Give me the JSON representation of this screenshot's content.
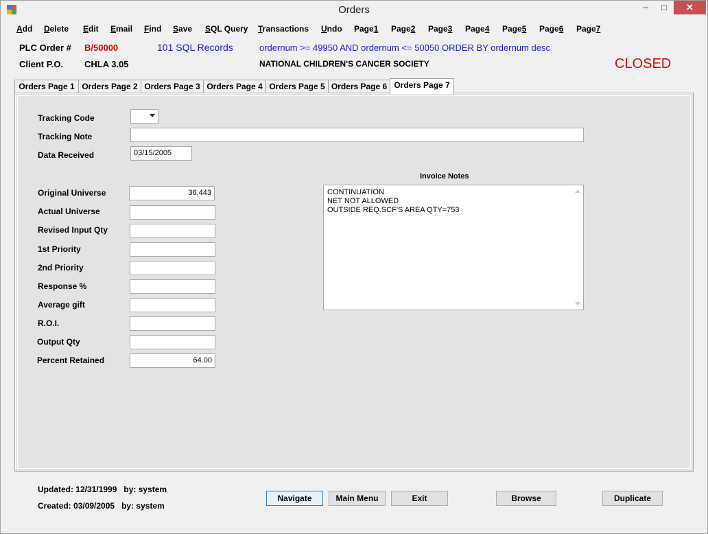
{
  "window": {
    "title": "Orders",
    "controls": {
      "minimize": "–",
      "maximize": "□",
      "close": "✕"
    }
  },
  "menu": [
    {
      "label": "Add",
      "accel": "A",
      "rest": "dd"
    },
    {
      "label": "Delete",
      "accel": "D",
      "rest": "elete"
    },
    {
      "label": "Edit",
      "accel": "E",
      "rest": "dit"
    },
    {
      "label": "Email",
      "accel": "E",
      "rest": "mail"
    },
    {
      "label": "Find",
      "accel": "F",
      "rest": "ind"
    },
    {
      "label": "Save",
      "accel": "S",
      "rest": "ave"
    },
    {
      "label": "SQL Query",
      "accel": "S",
      "rest": "QL Query"
    },
    {
      "label": "Transactions",
      "accel": "T",
      "rest": "ransactions"
    },
    {
      "label": "Undo",
      "accel": "U",
      "rest": "ndo"
    },
    {
      "label": "Page1",
      "pre": "Page",
      "accel": "1"
    },
    {
      "label": "Page2",
      "pre": "Page",
      "accel": "2"
    },
    {
      "label": "Page3",
      "pre": "Page",
      "accel": "3"
    },
    {
      "label": "Page4",
      "pre": "Page",
      "accel": "4"
    },
    {
      "label": "Page5",
      "pre": "Page",
      "accel": "5"
    },
    {
      "label": "Page6",
      "pre": "Page",
      "accel": "6"
    },
    {
      "label": "Page7",
      "pre": "Page",
      "accel": "7"
    }
  ],
  "header": {
    "plc_order_label": "PLC Order #",
    "plc_order_value": "B/50000",
    "sql_records": "101 SQL Records",
    "sql_filter": "ordernum >= 49950 AND ordernum <= 50050 ORDER BY ordernum desc",
    "client_po_label": "Client P.O.",
    "client_po_value": "CHLA 3.05",
    "client_name": "NATIONAL CHILDREN'S CANCER SOCIETY",
    "status": "CLOSED",
    "colors": {
      "red": "#e00000",
      "blue": "#1a1ad6"
    }
  },
  "tabs": [
    {
      "label": "Orders Page 1"
    },
    {
      "label": "Orders Page 2"
    },
    {
      "label": "Orders Page 3"
    },
    {
      "label": "Orders Page 4"
    },
    {
      "label": "Orders Page 5"
    },
    {
      "label": "Orders Page 6"
    },
    {
      "label": "Orders Page 7",
      "active": true
    }
  ],
  "form": {
    "tracking_code_label": "Tracking Code",
    "tracking_code_value": "",
    "tracking_note_label": "Tracking Note",
    "tracking_note_value": "",
    "data_received_label": "Data Received",
    "data_received_value": "03/15/2005",
    "original_universe_label": "Original Universe",
    "original_universe_value": "36,443",
    "actual_universe_label": "Actual Universe",
    "actual_universe_value": "",
    "revised_input_qty_label": "Revised Input Qty",
    "revised_input_qty_value": "",
    "first_priority_label": "1st Priority",
    "first_priority_value": "",
    "second_priority_label": "2nd Priority",
    "second_priority_value": "",
    "response_pct_label": "Response %",
    "response_pct_value": "",
    "average_gift_label": "Average gift",
    "average_gift_value": "",
    "roi_label": "R.O.I.",
    "roi_value": "",
    "output_qty_label": "Output Qty",
    "output_qty_value": "",
    "percent_retained_label": "Percent Retained",
    "percent_retained_value": "64.00",
    "invoice_notes_label": "Invoice Notes",
    "invoice_notes_lines": [
      "CONTINUATION",
      "NET NOT ALLOWED",
      "OUTSIDE REQ.SCF'S AREA QTY=753"
    ]
  },
  "footer": {
    "updated": "Updated: 12/31/1999",
    "updated_by": "by: system",
    "created": "Created: 03/09/2005",
    "created_by": "by: system"
  },
  "buttons": {
    "navigate": "Navigate",
    "main_menu": "Main Menu",
    "exit": "Exit",
    "browse": "Browse",
    "duplicate": "Duplicate"
  }
}
